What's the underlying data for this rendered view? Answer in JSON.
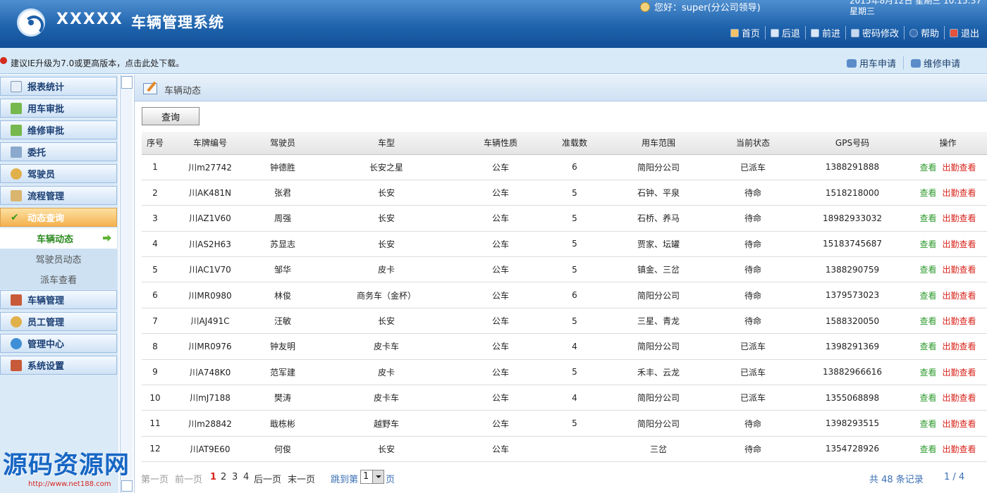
{
  "header": {
    "brand": "XXXXX",
    "title": "车辆管理系统",
    "greeting": "您好：super(分公司领导)",
    "datetime_line1": "2015年8月12日 星期三 10:15:37",
    "datetime_line2": "星期三",
    "nav": [
      {
        "label": "首页",
        "icon": "home-icon"
      },
      {
        "label": "后退",
        "icon": "back-icon"
      },
      {
        "label": "前进",
        "icon": "forward-icon"
      },
      {
        "label": "密码修改",
        "icon": "key-icon"
      },
      {
        "label": "帮助",
        "icon": "help-icon"
      },
      {
        "label": "退出",
        "icon": "exit-icon"
      }
    ]
  },
  "notice": {
    "text": "建议IE升级为7.0或更高版本，点击此处下载。",
    "links": [
      {
        "label": "用车申请",
        "icon": "car-apply-icon"
      },
      {
        "label": "维修申请",
        "icon": "repair-apply-icon"
      }
    ]
  },
  "sidebar": {
    "items": [
      {
        "label": "报表统计",
        "icon": "report-icon"
      },
      {
        "label": "用车审批",
        "icon": "approve-icon"
      },
      {
        "label": "维修审批",
        "icon": "approve-icon"
      },
      {
        "label": "委托",
        "icon": "delegate-icon"
      },
      {
        "label": "驾驶员",
        "icon": "driver-icon"
      },
      {
        "label": "流程管理",
        "icon": "flow-icon"
      },
      {
        "label": "动态查询",
        "icon": "check-icon",
        "active": true
      },
      {
        "label": "车辆管理",
        "icon": "tools-icon"
      },
      {
        "label": "员工管理",
        "icon": "employee-icon"
      },
      {
        "label": "管理中心",
        "icon": "globe-icon"
      },
      {
        "label": "系统设置",
        "icon": "tools-icon"
      }
    ],
    "subitems": [
      {
        "label": "车辆动态",
        "current": true
      },
      {
        "label": "驾驶员动态"
      },
      {
        "label": "派车查看"
      }
    ]
  },
  "panel": {
    "title": "车辆动态",
    "query_button": "查询"
  },
  "table": {
    "headers": [
      "序号",
      "车牌编号",
      "驾驶员",
      "车型",
      "车辆性质",
      "准载数",
      "用车范围",
      "当前状态",
      "GPS号码",
      "操作"
    ],
    "op_view": "查看",
    "op_dispatch": "出勤查看",
    "rows": [
      {
        "no": "1",
        "plate": "川m27742",
        "driver": "钟德胜",
        "model": "长安之星",
        "nature": "公车",
        "seats": "6",
        "scope": "简阳分公司",
        "status": "已派车",
        "gps": "1388291888"
      },
      {
        "no": "2",
        "plate": "川AK481N",
        "driver": "张君",
        "model": "长安",
        "nature": "公车",
        "seats": "5",
        "scope": "石钟、平泉",
        "status": "待命",
        "gps": "1518218000"
      },
      {
        "no": "3",
        "plate": "川AZ1V60",
        "driver": "周强",
        "model": "长安",
        "nature": "公车",
        "seats": "5",
        "scope": "石桥、养马",
        "status": "待命",
        "gps": "18982933032"
      },
      {
        "no": "4",
        "plate": "川AS2H63",
        "driver": "苏显志",
        "model": "长安",
        "nature": "公车",
        "seats": "5",
        "scope": "贾家、坛罐",
        "status": "待命",
        "gps": "15183745687"
      },
      {
        "no": "5",
        "plate": "川AC1V70",
        "driver": "邹华",
        "model": "皮卡",
        "nature": "公车",
        "seats": "5",
        "scope": "镇金、三岔",
        "status": "待命",
        "gps": "1388290759"
      },
      {
        "no": "6",
        "plate": "川MR0980",
        "driver": "林俊",
        "model": "商务车（金杯）",
        "nature": "公车",
        "seats": "6",
        "scope": "简阳分公司",
        "status": "待命",
        "gps": "1379573023"
      },
      {
        "no": "7",
        "plate": "川AJ491C",
        "driver": "汪敏",
        "model": "长安",
        "nature": "公车",
        "seats": "5",
        "scope": "三星、青龙",
        "status": "待命",
        "gps": "1588320050"
      },
      {
        "no": "8",
        "plate": "川MR0976",
        "driver": "钟友明",
        "model": "皮卡车",
        "nature": "公车",
        "seats": "4",
        "scope": "简阳分公司",
        "status": "已派车",
        "gps": "1398291369"
      },
      {
        "no": "9",
        "plate": "川A748K0",
        "driver": "范军建",
        "model": "皮卡",
        "nature": "公车",
        "seats": "5",
        "scope": "禾丰、云龙",
        "status": "已派车",
        "gps": "13882966616"
      },
      {
        "no": "10",
        "plate": "川mJ7188",
        "driver": "樊涛",
        "model": "皮卡车",
        "nature": "公车",
        "seats": "4",
        "scope": "简阳分公司",
        "status": "已派车",
        "gps": "1355068898"
      },
      {
        "no": "11",
        "plate": "川m28842",
        "driver": "戢栋彬",
        "model": "越野车",
        "nature": "公车",
        "seats": "5",
        "scope": "简阳分公司",
        "status": "待命",
        "gps": "1398293515"
      },
      {
        "no": "12",
        "plate": "川AT9E60",
        "driver": "何俊",
        "model": "长安",
        "nature": "公车",
        "seats": "",
        "scope": "三岔",
        "status": "待命",
        "gps": "1354728926"
      }
    ]
  },
  "pager": {
    "first": "第一页",
    "prev": "前一页",
    "pages": [
      "1",
      "2",
      "3",
      "4"
    ],
    "next": "后一页",
    "last": "末一页",
    "goto_prefix": "跳到第",
    "goto_value": "1",
    "goto_suffix": "页",
    "total": "共 48 条记录",
    "page_of": "1 / 4"
  },
  "watermark": {
    "text": "源码资源网",
    "url": "http://www.net188.com"
  },
  "colors": {
    "header_blue": "#1f63ad",
    "status_dispatched": "#2d9a2d",
    "status_waiting": "#d8251d",
    "active_menu": "#f4b14e"
  }
}
